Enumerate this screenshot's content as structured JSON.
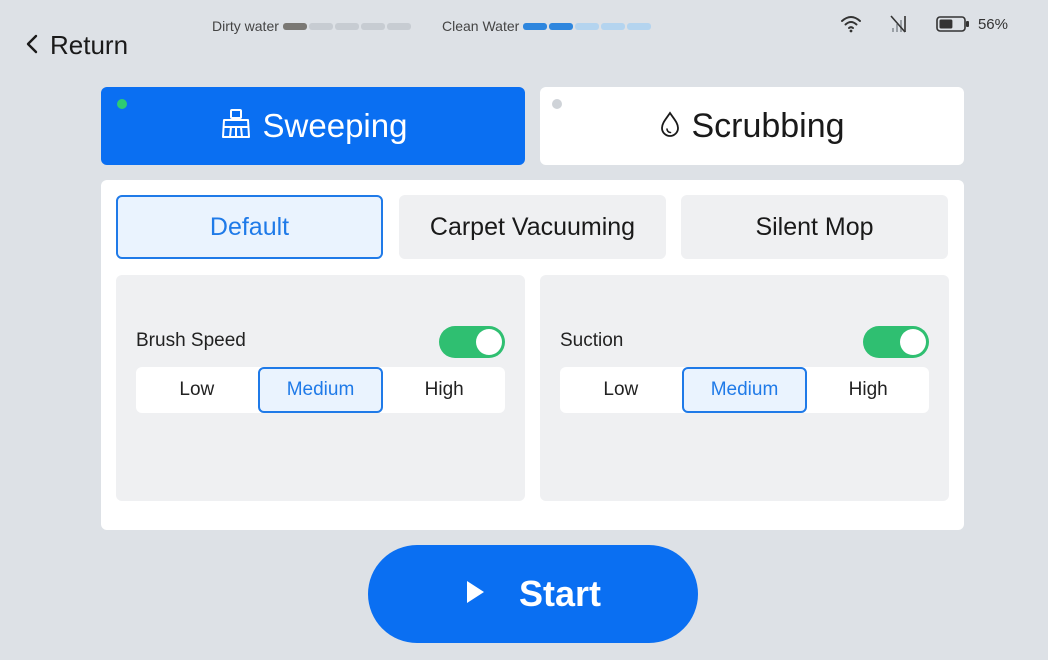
{
  "nav": {
    "return_label": "Return"
  },
  "status": {
    "dirty_water": {
      "label": "Dirty water",
      "level": 0.2,
      "segments": 5,
      "filled": 1
    },
    "clean_water": {
      "label": "Clean Water",
      "level": 0.4,
      "segments": 5,
      "filled": 2
    },
    "battery": {
      "percent": "56%",
      "level": 0.56
    },
    "icons": [
      "wifi-icon",
      "no-signal-icon",
      "battery-icon"
    ]
  },
  "modes": [
    {
      "label": "Sweeping",
      "icon": "broom-icon",
      "active": true
    },
    {
      "label": "Scrubbing",
      "icon": "water-drop-icon",
      "active": false
    }
  ],
  "presets": [
    {
      "label": "Default",
      "selected": true
    },
    {
      "label": "Carpet Vacuuming",
      "selected": false
    },
    {
      "label": "Silent Mop",
      "selected": false
    }
  ],
  "settings": [
    {
      "title": "Brush Speed",
      "enabled": true,
      "options": [
        "Low",
        "Medium",
        "High"
      ],
      "selected": "Medium"
    },
    {
      "title": "Suction",
      "enabled": true,
      "options": [
        "Low",
        "Medium",
        "High"
      ],
      "selected": "Medium"
    }
  ],
  "start": {
    "label": "Start",
    "icon": "play-icon"
  },
  "colors": {
    "accent": "#0a6ff2",
    "toggle_on": "#2fbf71",
    "active_dot": "#2ecc71",
    "background": "#dde1e6"
  }
}
